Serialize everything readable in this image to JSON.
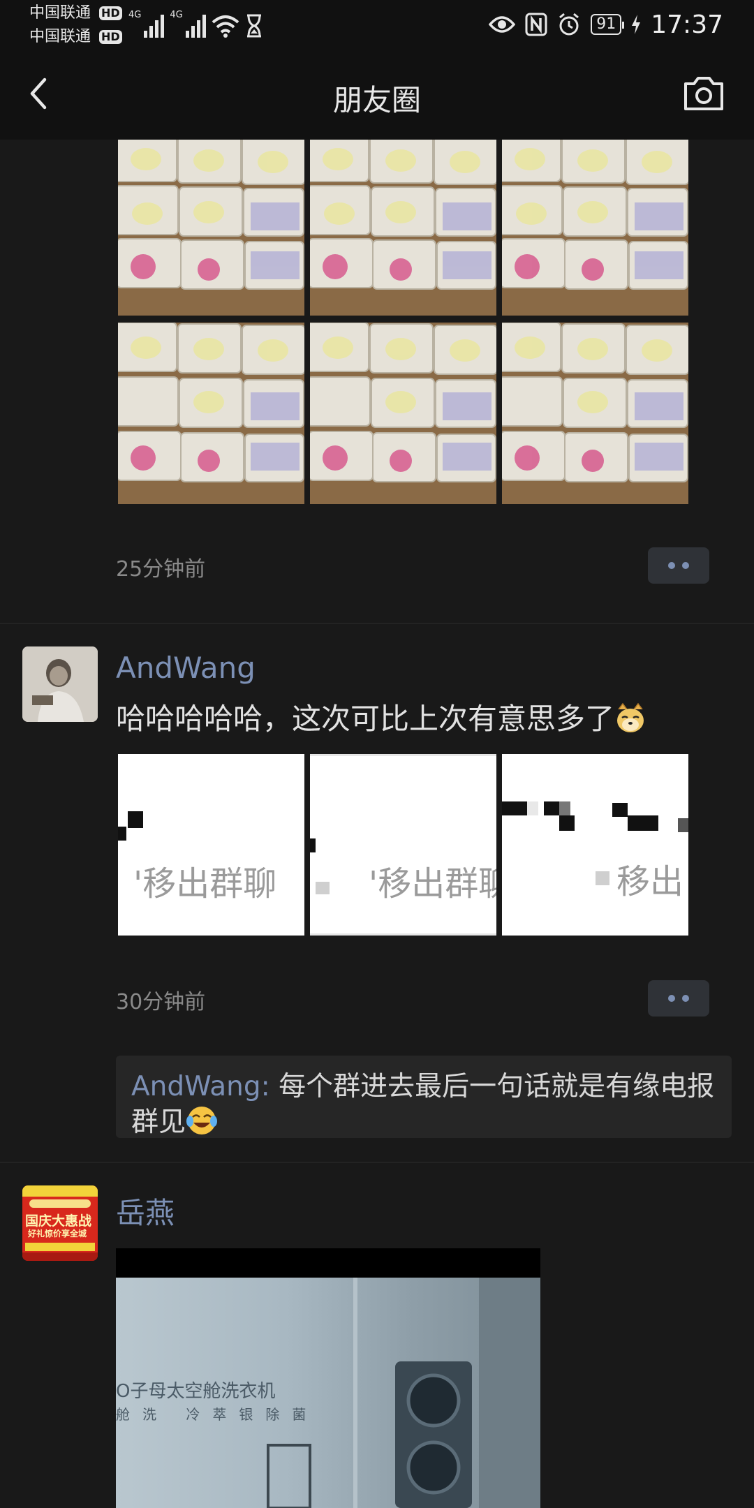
{
  "status_bar": {
    "carrier1": "中国联通",
    "carrier2": "中国联通",
    "hd": "HD",
    "network1": "4G",
    "network2": "4G",
    "battery": "91",
    "time": "17:37"
  },
  "header": {
    "title": "朋友圈"
  },
  "posts": [
    {
      "timestamp": "25分钟前"
    },
    {
      "username": "AndWang",
      "text": "哈哈哈哈哈，这次可比上次有意思多了",
      "images": [
        {
          "text": "'移出群聊"
        },
        {
          "text": "'移出群聊"
        },
        {
          "text": "移出"
        }
      ],
      "timestamp": "30分钟前",
      "comment": {
        "author": "AndWang",
        "separator": ": ",
        "text": "每个群进去最后一句话就是有缘电报群见"
      }
    },
    {
      "username": "岳燕",
      "video": {
        "caption": "O子母太空舱洗衣机",
        "caption2": "舱洗 冷萃银除菌"
      },
      "avatar_text": {
        "line1": "国庆大惠战",
        "line2": "好礼惊价享全城"
      }
    }
  ],
  "colors": {
    "background": "#191919",
    "link": "#7c90b5",
    "header": "#111111"
  }
}
